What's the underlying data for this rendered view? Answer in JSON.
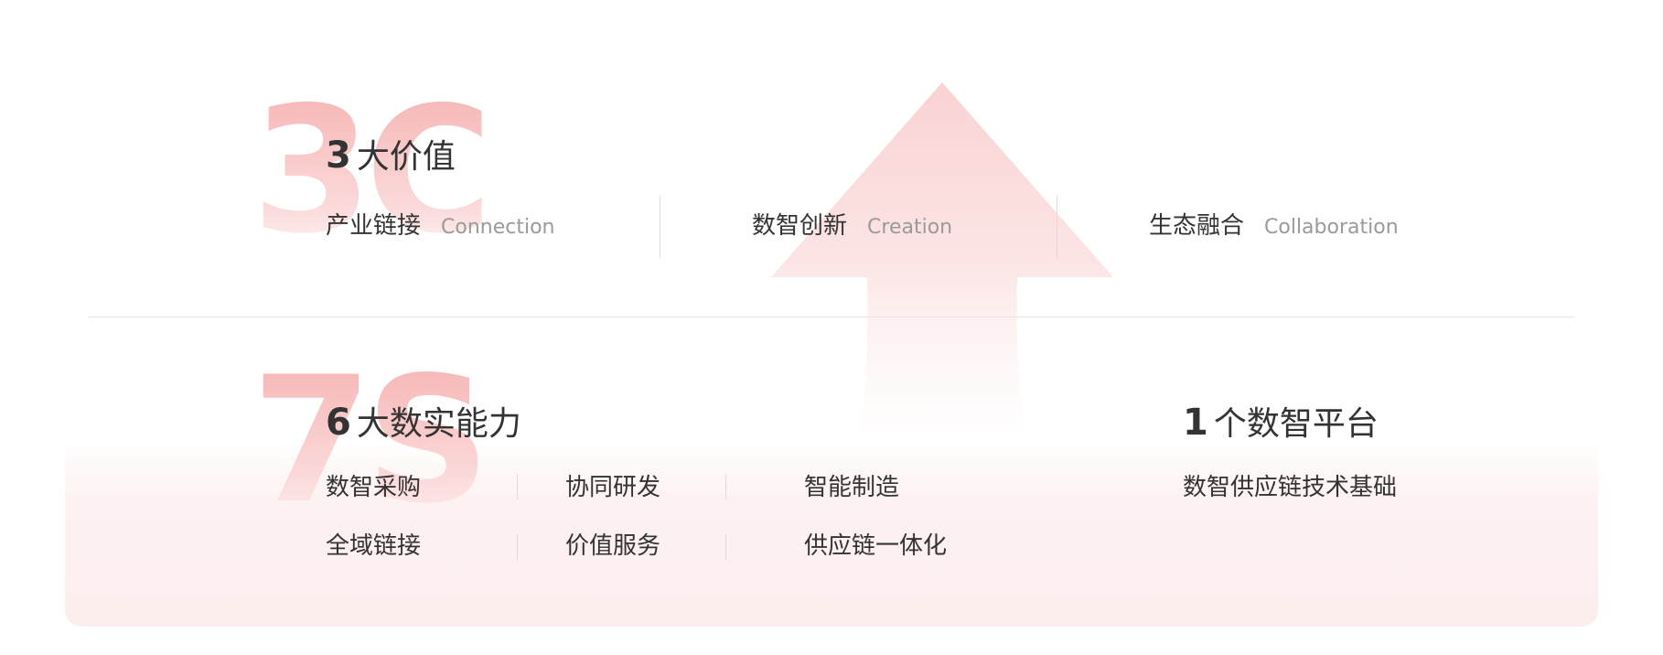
{
  "values_section": {
    "bg_letters": "3C",
    "heading_num": "3",
    "heading_text": "大价值",
    "items": [
      {
        "cn": "产业链接",
        "en": "Connection"
      },
      {
        "cn": "数智创新",
        "en": "Creation"
      },
      {
        "cn": "生态融合",
        "en": "Collaboration"
      }
    ]
  },
  "capabilities_section": {
    "bg_letters": "7S",
    "heading_num": "6",
    "heading_text": "大数实能力",
    "items": [
      "数智采购",
      "协同研发",
      "智能制造",
      "全域链接",
      "价值服务",
      "供应链一体化"
    ]
  },
  "platform_section": {
    "heading_num": "1",
    "heading_text": "个数智平台",
    "subtitle": "数智供应链技术基础"
  },
  "colors": {
    "accent_pink": "#f6b4b4",
    "arrow_pink": "#f9cfcf",
    "text_dark": "#333333",
    "text_muted": "#9a9a9a"
  }
}
